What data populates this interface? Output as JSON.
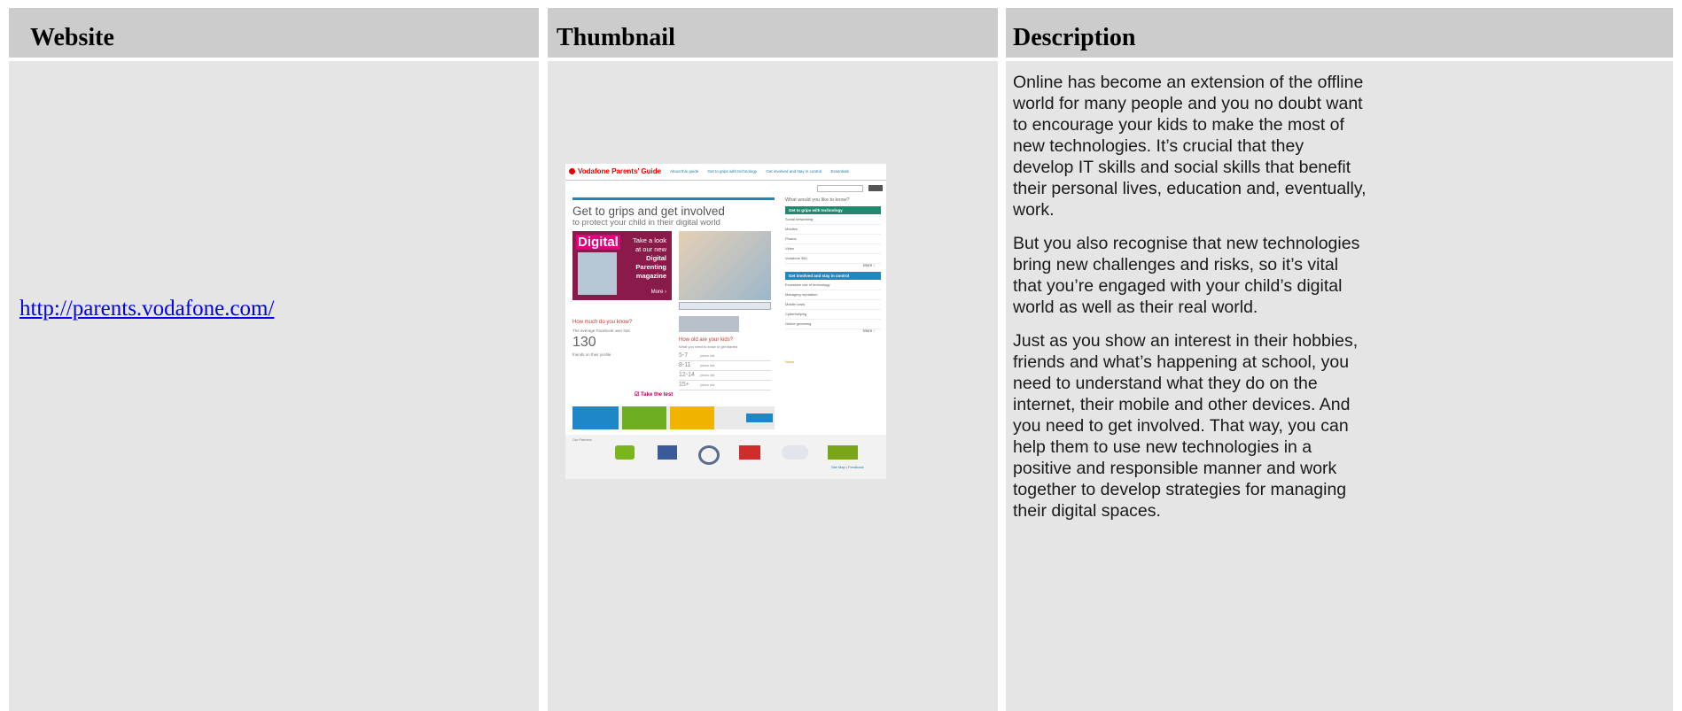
{
  "headers": {
    "website": "Website",
    "thumbnail": "Thumbnail",
    "description": "Description"
  },
  "row": {
    "link": "http://parents.vodafone.com/",
    "description": [
      "Online has become an extension of the offline world for many people and you no doubt want to encourage your kids to make the most of new technologies. It’s crucial that they develop IT skills and social skills that benefit their personal lives, education and, eventually, work.",
      "But you also recognise that new technologies bring new challenges and risks, so it’s vital that you’re engaged with your child’s digital world as well as their real world.",
      "Just as you show an interest in their hobbies, friends and what’s happening at school, you need to understand what they do on the internet, their mobile and other devices. And you need to get involved. That way, you can help them to use new technologies in a positive and responsible manner and work together to develop strategies for managing their digital spaces."
    ]
  },
  "thumbnail": {
    "logo": "Vodafone Parents’ Guide",
    "nav": [
      "About this guide",
      "Get to grips with technology",
      "Get involved and stay in control",
      "Essentials"
    ],
    "headline": "Get to grips and get involved",
    "subheadline": "to protect your child in their digital world",
    "magazine": {
      "badge": "Digital",
      "line1": "Take a look",
      "line2": "at our new",
      "line3": "Digital",
      "line4": "Parenting",
      "line5": "magazine",
      "more": "More"
    },
    "right_header": "What would you like to know?",
    "grips_bar": "Get to grips with technology",
    "grips_items": [
      "Social networking",
      "Mobiles",
      "Photos",
      "Video",
      "Vodafone 360"
    ],
    "control_bar": "Get involved and stay in control",
    "control_items": [
      "Excessive use of technology",
      "Managing reputation",
      "Mobile costs",
      "Cyberbullying",
      "Online grooming"
    ],
    "more": "More",
    "news_label": "News",
    "quiz_title": "How much do you know?",
    "quiz_avg": "The average Facebook user has",
    "quiz_number": "130",
    "quiz_friends": "friends on their profile",
    "take_test": "Take the test",
    "age_title": "How old are your kids?",
    "age_sub": "What you need to know to get started",
    "ages": [
      "5-7",
      "8-11",
      "12-14",
      "15+"
    ],
    "ages_suffix": "years old",
    "partners_label": "Our Partners",
    "partners": [
      "beatbullying",
      "Childnet",
      "CEOP",
      "Netsmart"
    ],
    "footer": "Site Map | Feedback",
    "colors": {
      "vodafone_red": "#e60000",
      "teal": "#1f8a70",
      "blue": "#1e87b5",
      "magenta": "#b0005a"
    }
  }
}
